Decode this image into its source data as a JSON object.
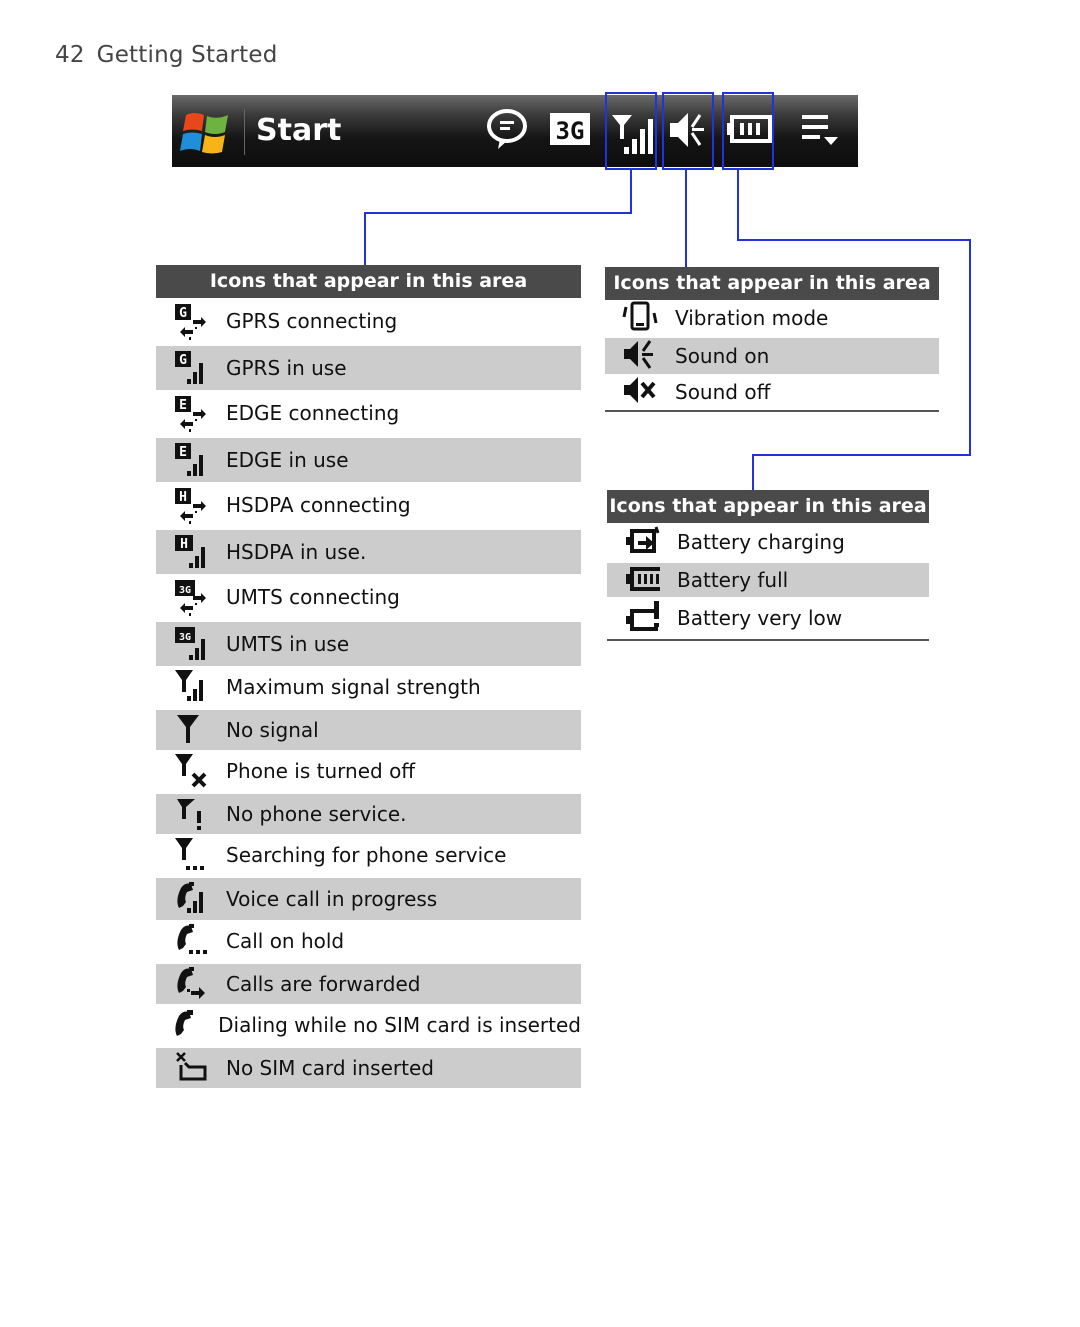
{
  "page_header": {
    "page_number": "42",
    "section_title": "Getting Started"
  },
  "taskbar": {
    "start_label": "Start",
    "icons": [
      "windows-flag-icon",
      "messaging-icon",
      "3g-icon",
      "signal-strength-icon",
      "sound-on-icon",
      "battery-icon",
      "menu-overflow-icon"
    ],
    "badge_3g": "3G"
  },
  "highlight_color": "#2233dd",
  "connectivity_panel": {
    "heading": "Icons that appear in this area",
    "items": [
      {
        "icon": "gprs-connecting-icon",
        "label": "GPRS connecting"
      },
      {
        "icon": "gprs-in-use-icon",
        "label": "GPRS in use"
      },
      {
        "icon": "edge-connecting-icon",
        "label": "EDGE connecting"
      },
      {
        "icon": "edge-in-use-icon",
        "label": "EDGE in use"
      },
      {
        "icon": "hsdpa-connecting-icon",
        "label": "HSDPA connecting"
      },
      {
        "icon": "hsdpa-in-use-icon",
        "label": "HSDPA in use."
      },
      {
        "icon": "umts-connecting-icon",
        "label": "UMTS connecting"
      },
      {
        "icon": "umts-in-use-icon",
        "label": "UMTS in use"
      },
      {
        "icon": "max-signal-icon",
        "label": "Maximum signal strength"
      },
      {
        "icon": "no-signal-icon",
        "label": "No signal"
      },
      {
        "icon": "phone-off-icon",
        "label": "Phone is turned off"
      },
      {
        "icon": "no-service-icon",
        "label": "No phone service."
      },
      {
        "icon": "searching-service-icon",
        "label": "Searching for phone service"
      },
      {
        "icon": "voice-call-icon",
        "label": "Voice call in progress"
      },
      {
        "icon": "call-hold-icon",
        "label": "Call on hold"
      },
      {
        "icon": "call-forward-icon",
        "label": "Calls are forwarded"
      },
      {
        "icon": "dial-no-sim-icon",
        "label": "Dialing while no SIM card is inserted"
      },
      {
        "icon": "no-sim-icon",
        "label": "No SIM card inserted"
      }
    ]
  },
  "sound_panel": {
    "heading": "Icons that appear in this area",
    "items": [
      {
        "icon": "vibration-icon",
        "label": "Vibration mode"
      },
      {
        "icon": "sound-on-icon",
        "label": "Sound on"
      },
      {
        "icon": "sound-off-icon",
        "label": "Sound off"
      }
    ]
  },
  "battery_panel": {
    "heading": "Icons that appear in this area",
    "items": [
      {
        "icon": "battery-charging-icon",
        "label": "Battery charging"
      },
      {
        "icon": "battery-full-icon",
        "label": "Battery full"
      },
      {
        "icon": "battery-low-icon",
        "label": "Battery very low"
      }
    ]
  }
}
